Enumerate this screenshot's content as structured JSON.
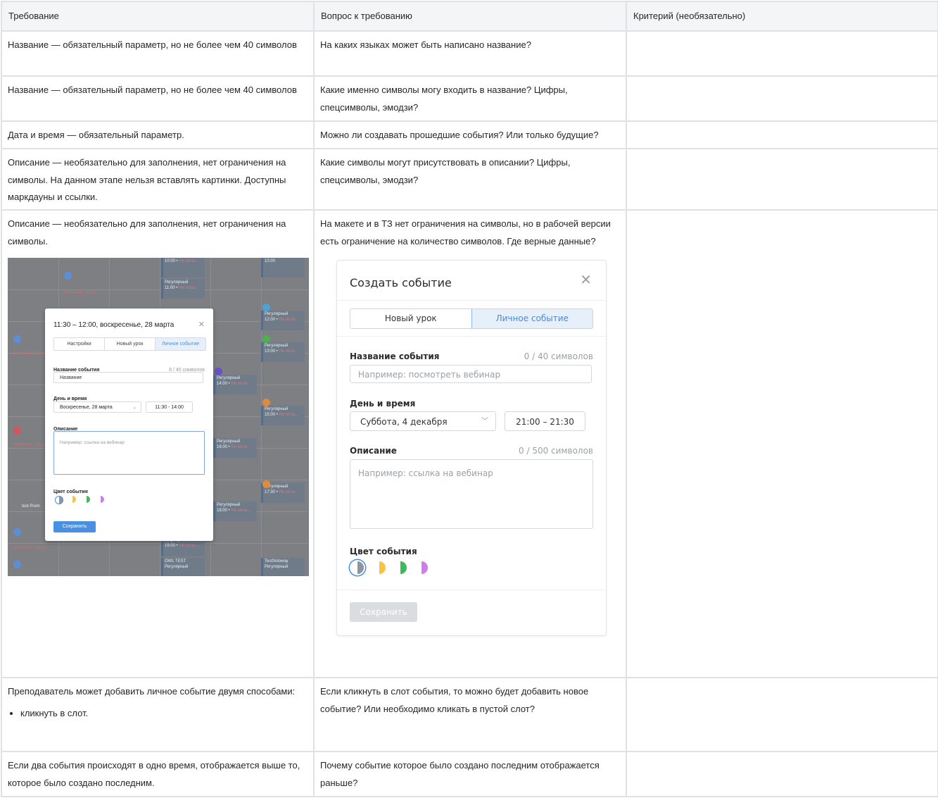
{
  "headers": [
    "Требование",
    "Вопрос к требованию",
    "Критерий (необязательно)"
  ],
  "rows": [
    {
      "req": "Название — обязательный параметр, но не более чем 40 символов",
      "q": "На каких языках может быть написано название?",
      "c": ""
    },
    {
      "req": "Название — обязательный параметр, но не более чем 40 символов",
      "q": "Какие именно символы могу входить в название? Цифры, спецсимволы, эмодзи?",
      "c": ""
    },
    {
      "req": "Дата и время — обязательный параметр.",
      "q": "Можно ли создавать прошедшие события? Или только будущие?",
      "c": ""
    },
    {
      "req": "Описание — необязательно для заполнения, нет ограничения на символы. На данном этапе нельзя вставлять картинки. Доступны маркдауны и ссылки.",
      "q": "Какие символы могут присутствовать в описании? Цифры, спецсимволы, эмодзи?",
      "c": ""
    },
    {
      "req": "Описание — необязательно для заполнения, нет ограничения на символы.",
      "q": "На макете и в ТЗ нет ограничения на символы, но в рабочей версии есть ограничение на количество символов. Где верные данные?",
      "c": ""
    },
    {
      "req": "Преподаватель может добавить личное событие двумя способами:",
      "req_bullet": "кликнуть в слот.",
      "q": "Если кликнуть в слот события, то можно будет добавить новое событие? Или необходимо кликать в пустой слот?",
      "c": ""
    },
    {
      "req": "Если два события происходят в одно время, отображается выше то, которое было создано последним.",
      "q": "Почему событие которое было создано последним отображается раньше?",
      "c": ""
    }
  ],
  "shot_left": {
    "title": "11:30 – 12:00, воскресенье, 28 марта",
    "tabs": [
      "Настройки",
      "Новый урок",
      "Личное событие"
    ],
    "name_label": "Название события",
    "name_count": "8 / 40 символов",
    "name_value": "Название",
    "dt_label": "День и время",
    "date_value": "Воскресенье, 28 марта",
    "time_value": "11:30 - 14:00",
    "desc_label": "Описание",
    "desc_placeholder": "Например: ссылка на вебинар",
    "color_label": "Цвет события",
    "save": "Сохранить",
    "bg_events": [
      {
        "l1": "10:00 • ",
        "st": "Не опла..."
      },
      {
        "l1": "Регулярный",
        "l2": "11:00 • ",
        "st": "Не опла..."
      },
      {
        "l1": "Регулярный",
        "l2": "12:00 • ",
        "st": "Не опла..."
      },
      {
        "l1": "Регулярный",
        "l2": "13:00 • ",
        "st": "Не опла..."
      },
      {
        "l1": "Регулярный",
        "l2": "14:00 • ",
        "st": "Не опла..."
      },
      {
        "l1": "Регулярный",
        "l2": "15:00 • ",
        "st": "Не опла..."
      },
      {
        "l1": "Регулярный",
        "l2": "16:00 • ",
        "st": "Не опла..."
      },
      {
        "l1": "Регулярный",
        "l2": "17:30 • ",
        "st": "Не опла..."
      },
      {
        "l1": "Регулярный",
        "l2": "18:00 • ",
        "st": "Не опла..."
      },
      {
        "l1": "Регулярный",
        "l2": "19:00 • ",
        "st": "Не опла..."
      }
    ],
    "status_text": "Отметьте статус",
    "owl": "OWL TEST",
    "testsolo": "TestSoloway",
    "testprem": "test Prem",
    "regular": "Регулярный",
    "ten": "10:00"
  },
  "shot_right": {
    "title": "Создать событие",
    "tab1": "Новый урок",
    "tab2": "Личное событие",
    "name_label": "Название события",
    "name_count": "0 / 40 символов",
    "name_placeholder": "Например: посмотреть вебинар",
    "dt_label": "День и время",
    "date_value": "Суббота, 4 декабря",
    "time_value": "21:00   –   21:30",
    "desc_label": "Описание",
    "desc_count": "0 / 500 символов",
    "desc_placeholder": "Например: ссылка на вебинар",
    "color_label": "Цвет события",
    "save": "Сохранить",
    "swatches": [
      "#8e959c",
      "#f5c542",
      "#3dbb5a",
      "#d07ce8"
    ]
  }
}
